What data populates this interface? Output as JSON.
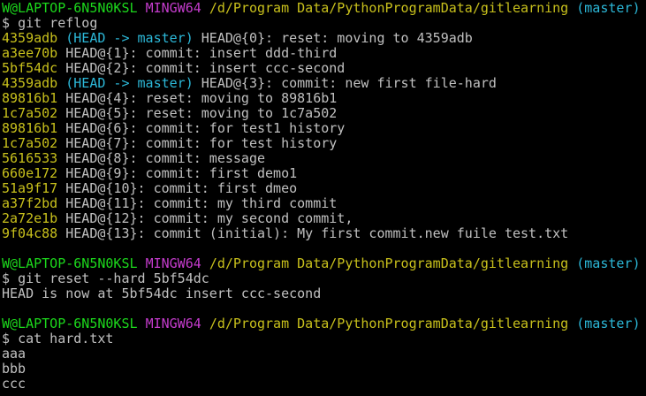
{
  "colors": {
    "background": "#000000",
    "text": "#c0c0c0",
    "user_host": "#1cd81c",
    "mingw": "#c43ccc",
    "path": "#c8c01c",
    "branch": "#2cb8d8",
    "hash": "#c8c01c",
    "head_ref": "#2cb8d8"
  },
  "prompts": [
    {
      "user_host": "W@LAPTOP-6N5N0KSL",
      "env": "MINGW64",
      "path": "/d/Program Data/PythonProgramData/gitlearning",
      "branch": "(master)",
      "symbol": "$",
      "command": "git reflog"
    },
    {
      "user_host": "W@LAPTOP-6N5N0KSL",
      "env": "MINGW64",
      "path": "/d/Program Data/PythonProgramData/gitlearning",
      "branch": "(master)",
      "symbol": "$",
      "command": "git reset --hard 5bf54dc"
    },
    {
      "user_host": "W@LAPTOP-6N5N0KSL",
      "env": "MINGW64",
      "path": "/d/Program Data/PythonProgramData/gitlearning",
      "branch": "(master)",
      "symbol": "$",
      "command": "cat hard.txt"
    }
  ],
  "reflog": [
    {
      "hash": "4359adb",
      "ref": "(HEAD -> master)",
      "text": "HEAD@{0}: reset: moving to 4359adb"
    },
    {
      "hash": "a3ee70b",
      "ref": "",
      "text": "HEAD@{1}: commit: insert ddd-third"
    },
    {
      "hash": "5bf54dc",
      "ref": "",
      "text": "HEAD@{2}: commit: insert ccc-second"
    },
    {
      "hash": "4359adb",
      "ref": "(HEAD -> master)",
      "text": "HEAD@{3}: commit: new first file-hard"
    },
    {
      "hash": "89816b1",
      "ref": "",
      "text": "HEAD@{4}: reset: moving to 89816b1"
    },
    {
      "hash": "1c7a502",
      "ref": "",
      "text": "HEAD@{5}: reset: moving to 1c7a502"
    },
    {
      "hash": "89816b1",
      "ref": "",
      "text": "HEAD@{6}: commit: for test1 history"
    },
    {
      "hash": "1c7a502",
      "ref": "",
      "text": "HEAD@{7}: commit: for test history"
    },
    {
      "hash": "5616533",
      "ref": "",
      "text": "HEAD@{8}: commit: message"
    },
    {
      "hash": "660e172",
      "ref": "",
      "text": "HEAD@{9}: commit: first demo1"
    },
    {
      "hash": "51a9f17",
      "ref": "",
      "text": "HEAD@{10}: commit: first dmeo"
    },
    {
      "hash": "a37f2bd",
      "ref": "",
      "text": "HEAD@{11}: commit: my third commit"
    },
    {
      "hash": "2a72e1b",
      "ref": "",
      "text": "HEAD@{12}: commit: my second commit,"
    },
    {
      "hash": "9f04c88",
      "ref": "",
      "text": "HEAD@{13}: commit (initial): My first commit.new fuile test.txt"
    }
  ],
  "reset_output": "HEAD is now at 5bf54dc insert ccc-second",
  "cat_output": [
    "aaa",
    "bbb",
    "ccc"
  ]
}
